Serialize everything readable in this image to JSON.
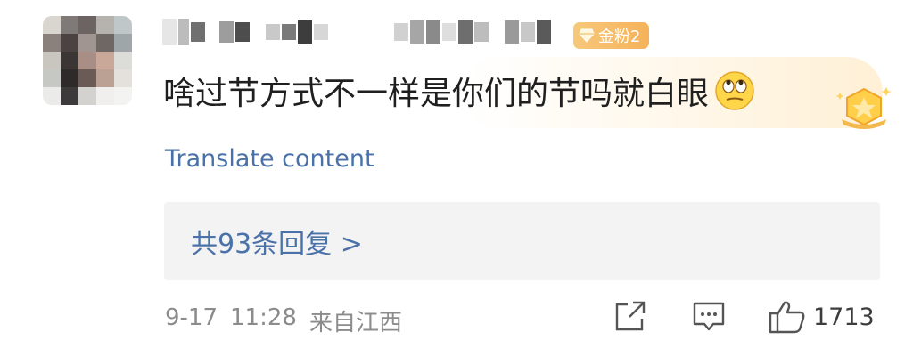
{
  "author": {
    "name": "",
    "badge_label": "金粉2"
  },
  "comment": {
    "text": "啥过节方式不一样是你们的节吗就白眼",
    "emoji": "eye-roll-emoji"
  },
  "translate_label": "Translate content",
  "replies": {
    "label": "共93条回复 >"
  },
  "meta": {
    "date": "9-17",
    "time": "11:28",
    "location": "来自江西"
  },
  "actions": {
    "like_count": "1713",
    "share_icon": "share-icon",
    "comment_icon": "comment-icon",
    "like_icon": "thumbs-up-icon"
  },
  "colors": {
    "link": "#4a72a8",
    "badge": "#f5b25a",
    "meta_text": "#8c8c8c"
  }
}
